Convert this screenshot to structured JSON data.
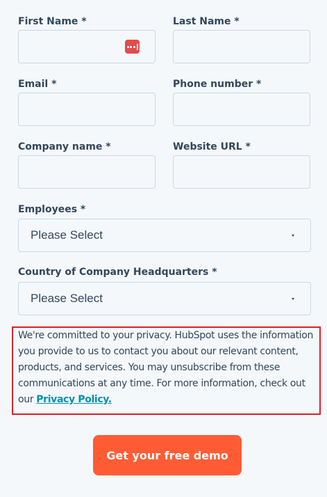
{
  "form": {
    "first_name": {
      "label": "First Name *",
      "value": ""
    },
    "last_name": {
      "label": "Last Name *",
      "value": ""
    },
    "email": {
      "label": "Email *",
      "value": ""
    },
    "phone": {
      "label": "Phone number *",
      "value": ""
    },
    "company": {
      "label": "Company name *",
      "value": ""
    },
    "website": {
      "label": "Website URL *",
      "value": ""
    },
    "employees": {
      "label": "Employees *",
      "selected": "Please Select"
    },
    "country": {
      "label": "Country of Company Headquarters *",
      "selected": "Please Select"
    }
  },
  "privacy": {
    "text": "We're committed to your privacy. HubSpot uses the information you provide to us to contact you about our relevant content, products, and services. You may unsubscribe from these communications at any time. For more information, check out our ",
    "link_label": "Privacy Policy."
  },
  "submit_label": "Get your free demo",
  "icons": {
    "password_manager": "password-manager-icon",
    "select_chevron": "chevron-down-icon"
  },
  "colors": {
    "primary_button": "#ff5c35",
    "link": "#0091ae",
    "highlight_border": "#d9202a",
    "password_icon": "#e44b4b"
  }
}
